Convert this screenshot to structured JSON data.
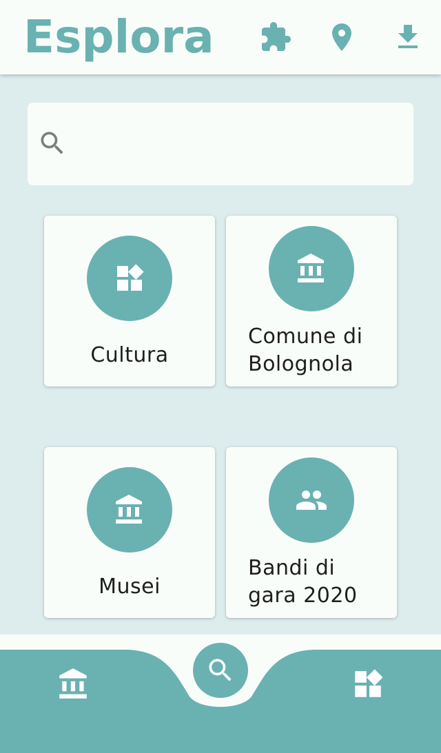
{
  "header": {
    "title": "Esplora",
    "actions": [
      {
        "icon": "puzzle-icon"
      },
      {
        "icon": "location-pin-icon"
      },
      {
        "icon": "download-icon"
      }
    ]
  },
  "search": {
    "icon": "search-icon",
    "value": "",
    "placeholder": ""
  },
  "categories": [
    {
      "label": "Cultura",
      "icon": "widgets-icon"
    },
    {
      "label": "Comune di Bolognola",
      "icon": "institution-icon"
    },
    {
      "label": "Musei",
      "icon": "institution-icon"
    },
    {
      "label": "Bandi di gara 2020",
      "icon": "people-icon"
    }
  ],
  "bottom_nav": {
    "left_icon": "institution-icon",
    "center_icon": "search-icon",
    "right_icon": "widgets-icon"
  },
  "colors": {
    "accent": "#6ab1b2",
    "background": "#ddedee",
    "surface": "#f9fdf9"
  }
}
